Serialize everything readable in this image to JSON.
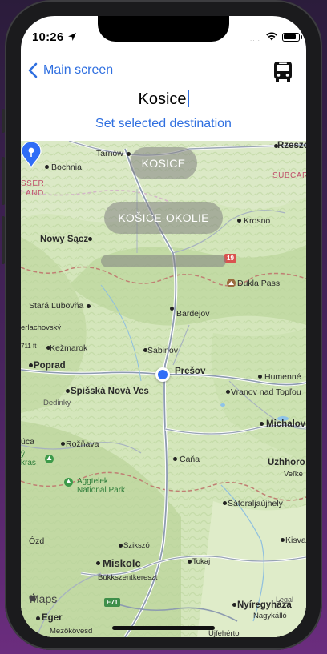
{
  "status_bar": {
    "time": "10:26",
    "signal": "....",
    "icons": [
      "location-arrow-icon",
      "wifi-icon",
      "battery-icon"
    ]
  },
  "nav": {
    "back_label": "Main screen",
    "right_icon": "bus-icon"
  },
  "search": {
    "value": "Kosice"
  },
  "set_destination_label": "Set selected destination",
  "suggestions": [
    "KOSICE",
    "KOŠICE-OKOLIE",
    ""
  ],
  "map": {
    "labels": {
      "rzeszow": "Rzeszó",
      "tarnow": "Tarnów",
      "bochnia": "Bochnia",
      "lesser_poland": "SSER\nLAND",
      "subcarpathian": "SUBCAR",
      "nowy_sacz": "Nowy Sącz",
      "krosno": "Krosno",
      "dukla_pass": "Dukla Pass",
      "stara_lubovna": "Stará Ľubovňa",
      "bardejov": "Bardejov",
      "gerlachovsky": "erlachovský",
      "elevation": "711 ft",
      "kezmarok": "Kežmarok",
      "sabinov": "Sabinov",
      "poprad": "Poprad",
      "presov": "Prešov",
      "humenne": "Humenné",
      "spisska": "Spišská Nová Ves",
      "vranov": "Vranov nad Topľou",
      "dedinky": "Dedinky",
      "michalovce": "Michalovc",
      "uca": "úca",
      "roznava": "Rožňava",
      "kras": "ý\nkras",
      "uzhhorod": "Uzhhoro",
      "velke": "Veľké",
      "cana": "Čaňa",
      "aggtelek": "Aggtelek\nNational Park",
      "satoraljaujhely": "Sátoraljaújhely",
      "ozd": "Ózd",
      "szikszo": "Szikszó",
      "kisva": "Kisva",
      "miskolc": "Miskolc",
      "tokaj": "Tokaj",
      "bukkszent": "Bükkszentkereszt",
      "eger": "Eger",
      "nyiregyhaza": "Nyíregyháza",
      "nagykallo": "Nagykálló",
      "mezokovesd": "Mezőkövesd",
      "ujfeherto": "Újfehérto"
    },
    "road_badges": {
      "r19": "19",
      "e71": "E71"
    },
    "maps_brand": "Maps",
    "legal": "Legal"
  }
}
